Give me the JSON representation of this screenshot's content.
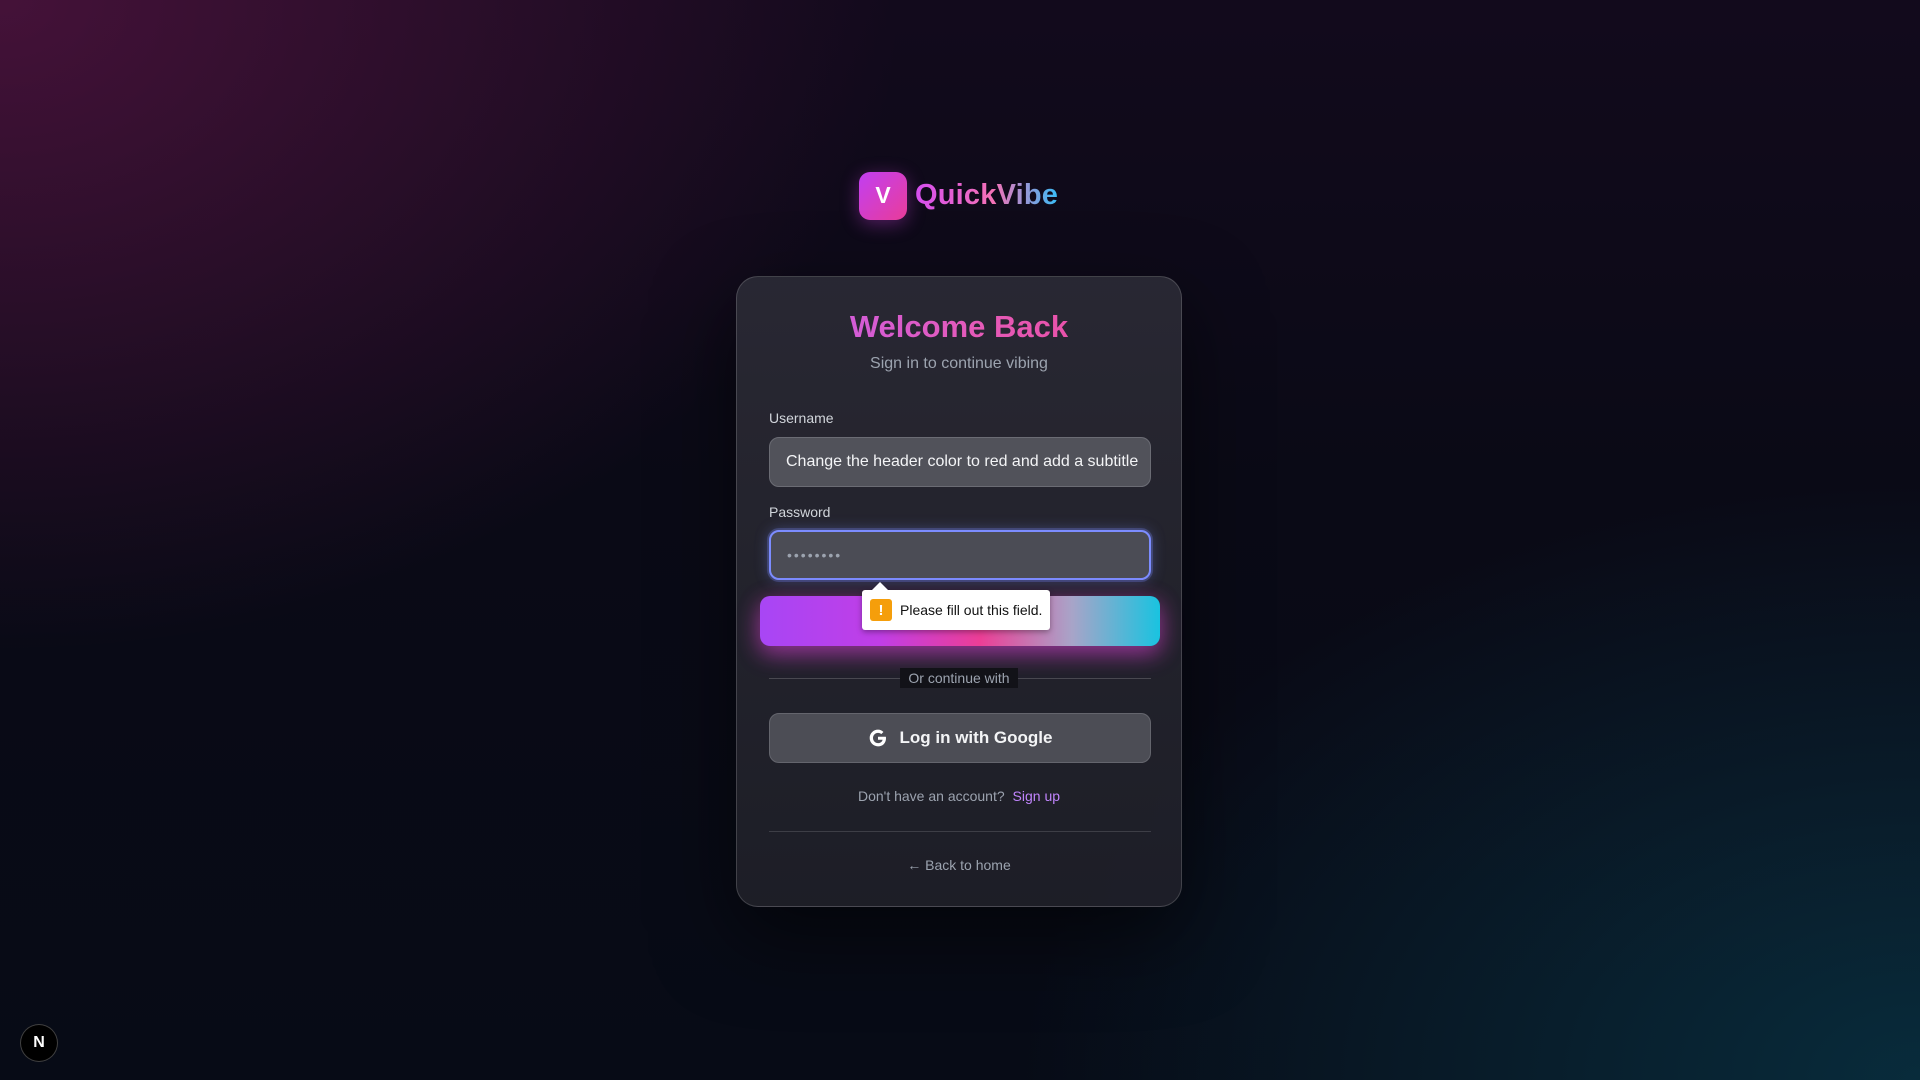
{
  "brand": {
    "mark_letter": "V",
    "name": "QuickVibe"
  },
  "card": {
    "title": "Welcome Back",
    "subtitle": "Sign in to continue vibing"
  },
  "form": {
    "username_label": "Username",
    "username_value": "Change the header color to red and add a subtitle",
    "password_label": "Password",
    "password_placeholder": "••••••••",
    "submit_label": "",
    "validation_message": "Please fill out this field."
  },
  "divider": {
    "text": "Or continue with"
  },
  "google": {
    "label": "Log in with Google",
    "icon": "google-g-icon"
  },
  "signup": {
    "prompt": "Don't have an account?",
    "link": "Sign up"
  },
  "back": {
    "label": "← Back to home"
  },
  "corner_badge": {
    "letter": "N",
    "icon": "framework-badge-icon"
  },
  "colors": {
    "accent_purple": "#c13ef2",
    "accent_pink": "#ec4899",
    "accent_cyan": "#19c3e0",
    "focus_ring": "#7c8cff",
    "link": "#c084fc",
    "warning": "#f59e0b"
  }
}
